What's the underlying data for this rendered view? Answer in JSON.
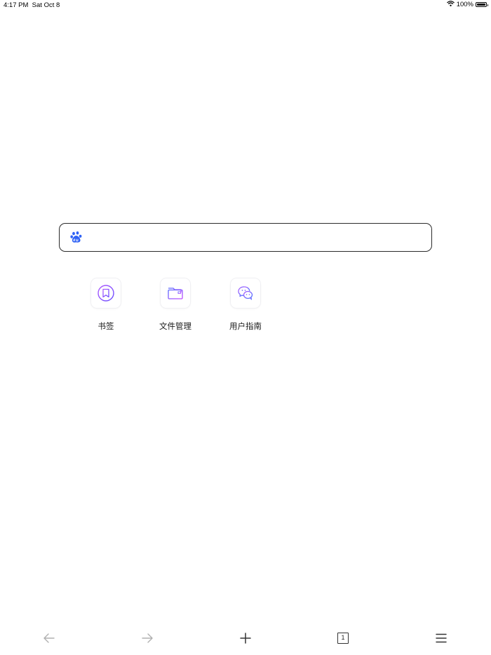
{
  "status_bar": {
    "time": "4:17 PM",
    "date": "Sat Oct 8",
    "battery_percent": "100%",
    "wifi_icon": "wifi-icon",
    "battery_icon": "battery-full-icon",
    "battery_level": 1.0
  },
  "search": {
    "engine_icon": "baidu-paw-icon",
    "engine_color": "#2f62f5",
    "value": "",
    "placeholder": ""
  },
  "shortcuts": [
    {
      "label": "书签",
      "icon": "bookmark-icon"
    },
    {
      "label": "文件管理",
      "icon": "folder-icon"
    },
    {
      "label": "用户指南",
      "icon": "chat-bubbles-icon"
    }
  ],
  "toolbar": {
    "back_icon": "arrow-left-icon",
    "forward_icon": "arrow-right-icon",
    "new_tab_icon": "plus-icon",
    "tabs_count": "1",
    "menu_icon": "hamburger-menu-icon"
  },
  "colors": {
    "accent_purple": "#8a4dff",
    "accent_blue": "#3a6cff",
    "inactive_gray": "#b0b0b0",
    "icon_dark": "#333333"
  }
}
